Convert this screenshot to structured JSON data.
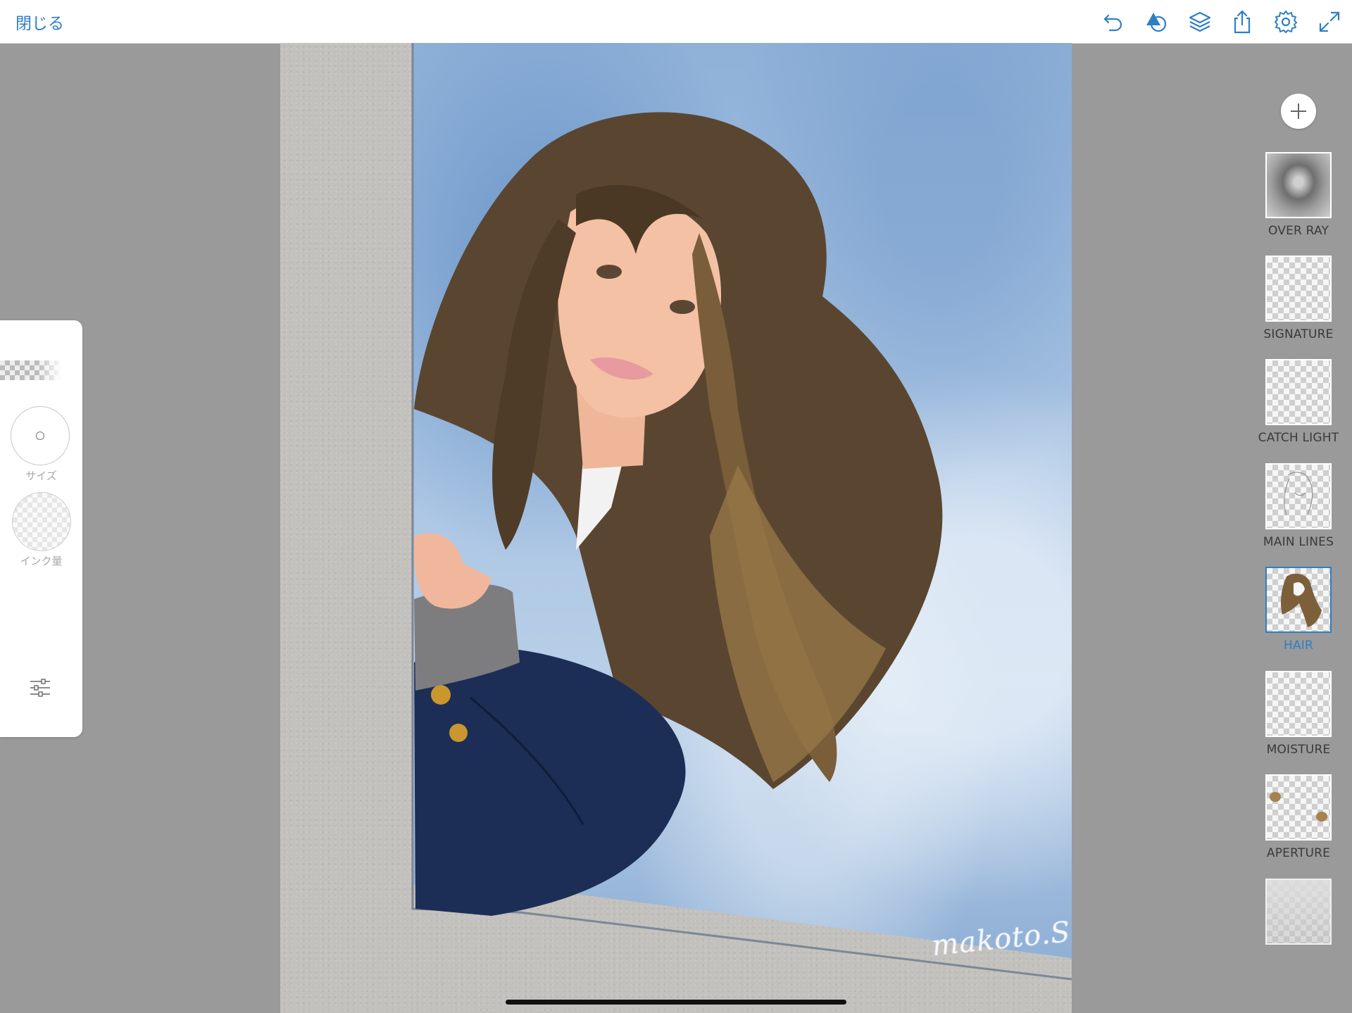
{
  "topbar": {
    "close_label": "閉じる",
    "icons": [
      "undo-icon",
      "shape-icon",
      "layers-icon",
      "share-icon",
      "settings-icon",
      "fullscreen-icon"
    ],
    "accent_color": "#2d7fc4"
  },
  "tools": {
    "size_label": "サイズ",
    "ink_label": "インク量"
  },
  "canvas": {
    "signature": "makoto.S"
  },
  "layers": {
    "items": [
      {
        "name": "OVER RAY",
        "active": false
      },
      {
        "name": "SIGNATURE",
        "active": false
      },
      {
        "name": "CATCH LIGHT",
        "active": false
      },
      {
        "name": "MAIN LINES",
        "active": false
      },
      {
        "name": "HAIR",
        "active": true
      },
      {
        "name": "MOISTURE",
        "active": false
      },
      {
        "name": "APERTURE",
        "active": false
      },
      {
        "name": "",
        "active": false
      }
    ]
  }
}
